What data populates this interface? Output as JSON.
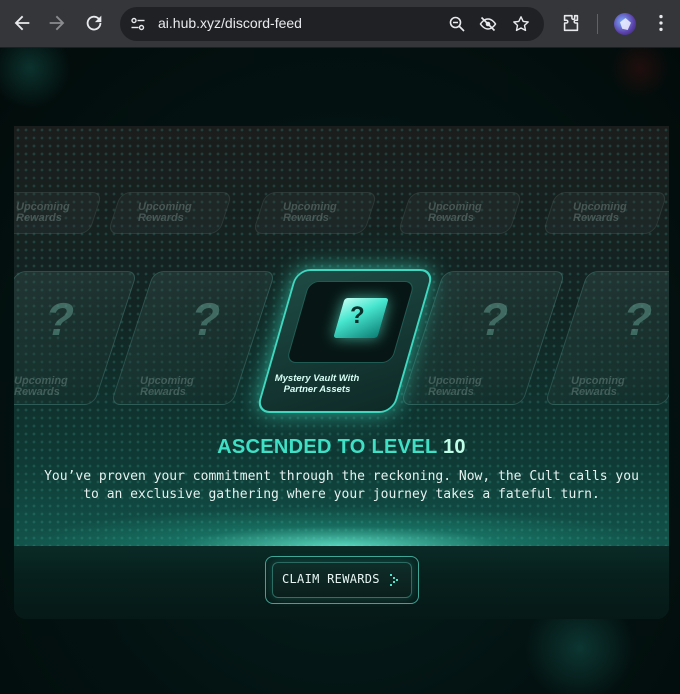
{
  "browser": {
    "url": "ai.hub.xyz/discord-feed",
    "back_icon": "arrow-left-icon",
    "forward_icon": "arrow-right-icon",
    "reload_icon": "reload-icon",
    "site_info_icon": "tune-icon",
    "omnibox_icons": [
      "zoom-icon",
      "eye-off-icon",
      "star-icon"
    ],
    "toolbar_icons": [
      "extensions-icon",
      "profile-avatar",
      "more-vert-icon"
    ]
  },
  "rewards": {
    "tile_label": "Upcoming Rewards",
    "tile_label_line1": "Upcoming",
    "tile_label_line2": "Rewards",
    "mystery_glyph": "?",
    "featured": {
      "label_line1": "Mystery Vault With",
      "label_line2": "Partner Assets"
    }
  },
  "headline": {
    "prefix": "ASCENDED TO LEVEL",
    "level": "10"
  },
  "description": "You’ve proven your commitment through the reckoning. Now, the Cult calls you to an exclusive gathering where your journey takes a fateful turn.",
  "claim_button": {
    "label": "CLAIM REWARDS"
  },
  "colors": {
    "accent": "#3fe0c6",
    "level_highlight": "#bfffe8",
    "background": "#020d0c"
  }
}
